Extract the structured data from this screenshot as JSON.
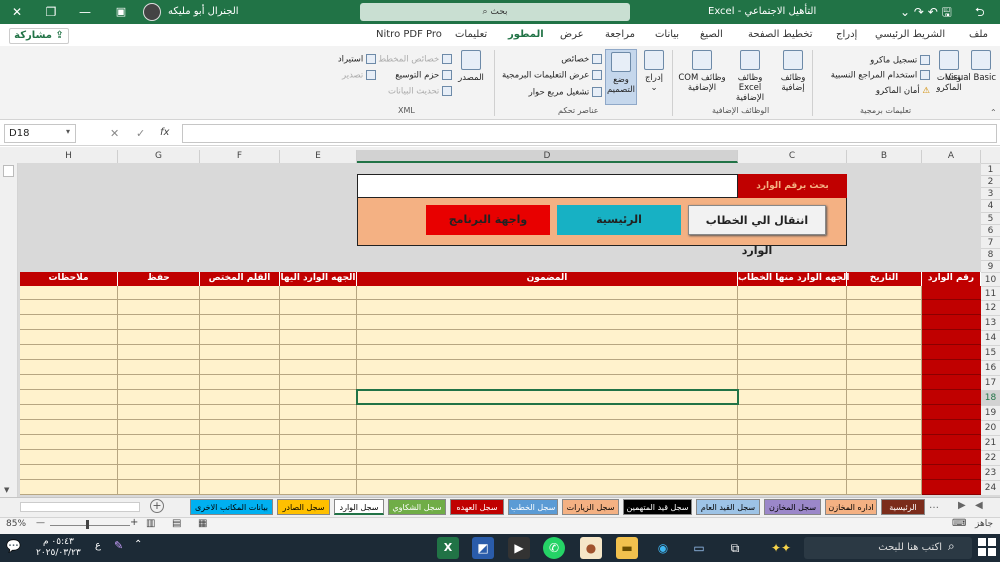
{
  "titlebar": {
    "title": "التأهيل الاجتماعي",
    "app": "Excel",
    "separator": "-",
    "user": "الجنرال أبو مليكه",
    "search": "بحث",
    "close": "✕",
    "restore": "❐",
    "minimize": "—"
  },
  "tabs": [
    "ملف",
    "الشريط الرئيسي",
    "إدراج",
    "تخطيط الصفحة",
    "الصيغ",
    "بيانات",
    "مراجعة",
    "عرض",
    "المطور",
    "تعليمات",
    "Nitro PDF Pro"
  ],
  "share": "مشاركة",
  "ribbon": {
    "code": {
      "vb": "Visual Basic",
      "macros": "وحدات الماكرو",
      "record": "تسجيل ماكرو",
      "relative": "استخدام المراجع النسبية",
      "security": "أمان الماكرو",
      "group": "تعليمات برمجية"
    },
    "addins": {
      "addins": "وظائف إضافية",
      "excel": "وظائف Excel الإضافية",
      "com": "وظائف COM الإضافية",
      "group": "الوظائف الإضافية"
    },
    "controls": {
      "insert": "إدراج",
      "design": "وضع التصميم",
      "props": "خصائص",
      "viewcode": "عرض التعليمات البرمجية",
      "dialog": "تشغيل مربع حوار",
      "group": "عناصر تحكم"
    },
    "xml": {
      "source": "المصدر",
      "mapprops": "خصائص المخطط",
      "packs": "حزم التوسيع",
      "refresh": "تحديث البيانات",
      "import": "استيراد",
      "export": "تصدير",
      "group": "XML"
    }
  },
  "formula": {
    "namebox": "D18",
    "cancel": "✕",
    "enter": "✓",
    "fx": "fx",
    "value": ""
  },
  "columns": [
    "A",
    "B",
    "C",
    "D",
    "E",
    "F",
    "G",
    "H"
  ],
  "rows": [
    "1",
    "2",
    "3",
    "4",
    "5",
    "6",
    "7",
    "8",
    "9",
    "10",
    "11",
    "12",
    "13",
    "14",
    "15",
    "16",
    "17",
    "18",
    "19",
    "20",
    "21",
    "22",
    "23",
    "24"
  ],
  "panel": {
    "search_label": "بحث برقم الوارد",
    "search_value": "",
    "btn_goto": "انتقال الي الخطاب الوارد",
    "btn_main": "الرئيسية",
    "btn_ui": "واجهة البرنامج"
  },
  "headers": [
    "رقم الوارد",
    "التاريخ",
    "الجهه الوارد منها الخطاب",
    "المضمون",
    "الجهه الوارد اليها",
    "القلم المختص",
    "حفظ",
    "ملاحظات"
  ],
  "sheets": [
    {
      "label": "الرئيسية",
      "color": "#7b2c1b",
      "fg": "#fff"
    },
    {
      "label": "اداره المخازن",
      "color": "#f4b183",
      "fg": "#000"
    },
    {
      "label": "سجل المخازن",
      "color": "#9b87c9",
      "fg": "#000"
    },
    {
      "label": "سجل القيد العام",
      "color": "#9dc3e6",
      "fg": "#000"
    },
    {
      "label": "سجل قيد المتهمين",
      "color": "#000000",
      "fg": "#fff"
    },
    {
      "label": "سجل الزيارات",
      "color": "#f4b183",
      "fg": "#000"
    },
    {
      "label": "سجل الخطب",
      "color": "#5b9bd5",
      "fg": "#fff"
    },
    {
      "label": "سجل العهده",
      "color": "#c00000",
      "fg": "#fff"
    },
    {
      "label": "سجل الشكاوي",
      "color": "#70ad47",
      "fg": "#fff"
    },
    {
      "label": "سجل الوارد",
      "color": "#ffffff",
      "fg": "#000"
    },
    {
      "label": "سجل الصادر",
      "color": "#ffc000",
      "fg": "#000"
    },
    {
      "label": "بيانات المكاتب الاخرى",
      "color": "#00b0f0",
      "fg": "#000"
    }
  ],
  "status": {
    "ready": "جاهز",
    "zoom": "85%",
    "minus": "—",
    "plus": "+"
  },
  "taskbar": {
    "search": "اكتب هنا للبحث",
    "time": "٠٥:٤٣ م",
    "date": "٢٠٢٥/٠٣/٢٣",
    "lang": "ع"
  }
}
